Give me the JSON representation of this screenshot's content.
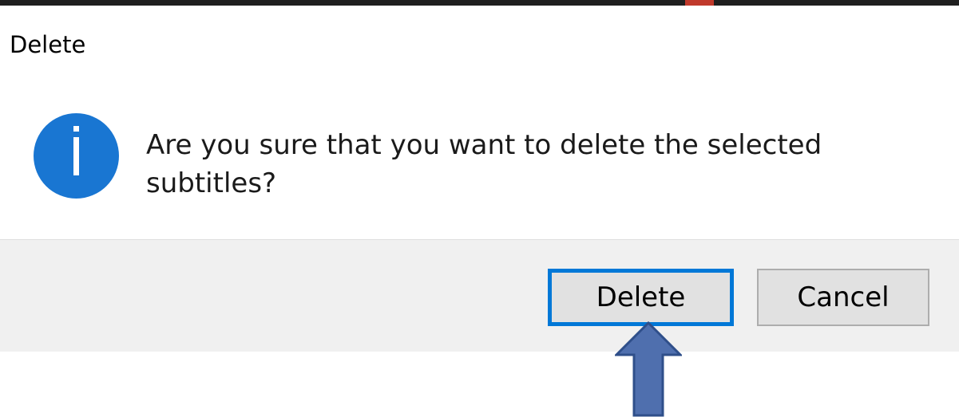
{
  "dialog": {
    "title": "Delete",
    "icon": "info-icon",
    "message": "Are you sure that you want to delete the selected subtitles?",
    "buttons": {
      "delete_label": "Delete",
      "cancel_label": "Cancel"
    }
  },
  "colors": {
    "icon_blue": "#1976d2",
    "focus_border": "#0078d7",
    "button_bar": "#f0f0f0",
    "annotation_arrow": "#4f6fae"
  },
  "annotation": {
    "icon": "up-arrow-icon"
  }
}
